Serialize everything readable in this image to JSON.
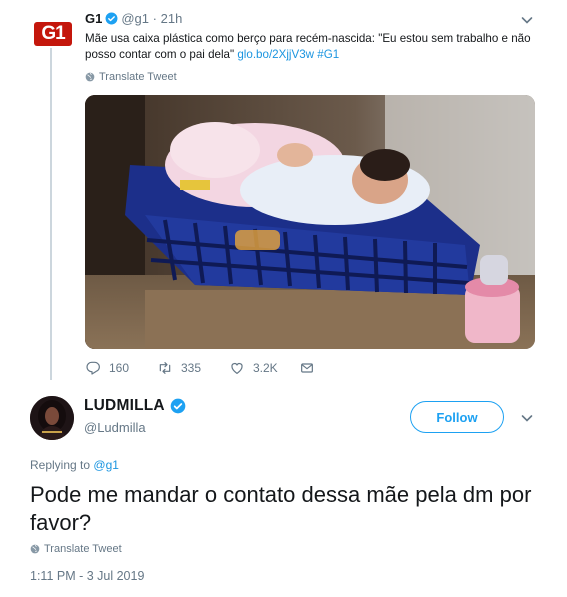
{
  "tweet": {
    "author_name": "G1",
    "logo_text": "G1",
    "handle": "@g1",
    "separator": "·",
    "time": "21h",
    "text": "Mãe usa caixa plástica como berço para recém-nascida: \"Eu estou sem trabalho e não posso contar com o pai dela\"",
    "link": "glo.bo/2XjjV3w",
    "hashtag": "#G1",
    "translate_label": "Translate Tweet",
    "actions": {
      "replies": "160",
      "retweets": "335",
      "likes": "3.2K"
    },
    "icons": [
      "verified-badge-icon",
      "chevron-down-icon",
      "globe-icon",
      "reply-icon",
      "retweet-icon",
      "like-icon",
      "direct-message-icon"
    ]
  },
  "reply": {
    "author_name": "LUDMILLA",
    "handle": "@Ludmilla",
    "follow_label": "Follow",
    "replying_prefix": "Replying to",
    "replying_to": "@g1",
    "text": "Pode me mandar o contato dessa mãe pela dm por favor?",
    "translate_label": "Translate Tweet",
    "timestamp": "1:11 PM - 3 Jul 2019"
  },
  "colors": {
    "accent": "#1da1f2",
    "link": "#1b95e0",
    "muted": "#657786",
    "g1_red": "#c4170c"
  }
}
